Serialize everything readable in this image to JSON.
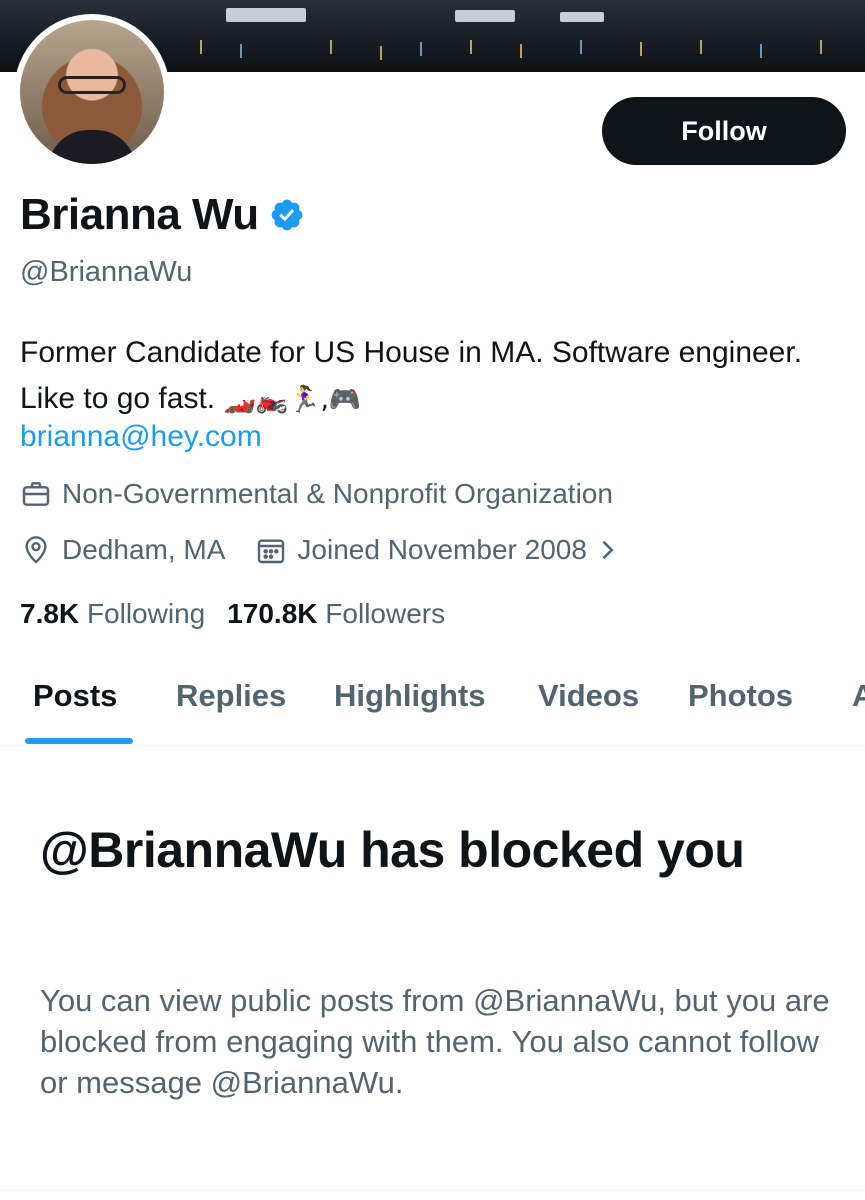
{
  "profile": {
    "display_name": "Brianna Wu",
    "handle": "@BriannaWu",
    "bio_text": "Former Candidate for US House in MA. Software engineer. Like to go fast.",
    "bio_emojis": "🏎️🏍️🏃‍♀️,🎮",
    "link": "brianna@hey.com",
    "category": "Non-Governmental & Nonprofit Organization",
    "location": "Dedham, MA",
    "joined": "Joined November 2008",
    "following_count": "7.8K",
    "following_label": "Following",
    "followers_count": "170.8K",
    "followers_label": "Followers"
  },
  "actions": {
    "follow_label": "Follow"
  },
  "tabs": [
    {
      "label": "Posts"
    },
    {
      "label": "Replies"
    },
    {
      "label": "Highlights"
    },
    {
      "label": "Videos"
    },
    {
      "label": "Photos"
    },
    {
      "label": "A"
    }
  ],
  "blocked": {
    "title": "@BriannaWu has blocked you",
    "description": "You can view public posts from @BriannaWu, but you are blocked from engaging with them. You also cannot follow or message @BriannaWu."
  },
  "colors": {
    "accent": "#1d9bf0",
    "text": "#0f1419",
    "secondary": "#536471",
    "button_bg": "#0f1419"
  },
  "icons": {
    "verified": "verified-badge-icon",
    "category": "briefcase-icon",
    "location": "location-pin-icon",
    "joined": "calendar-icon",
    "joined_chevron": "chevron-right-icon"
  }
}
